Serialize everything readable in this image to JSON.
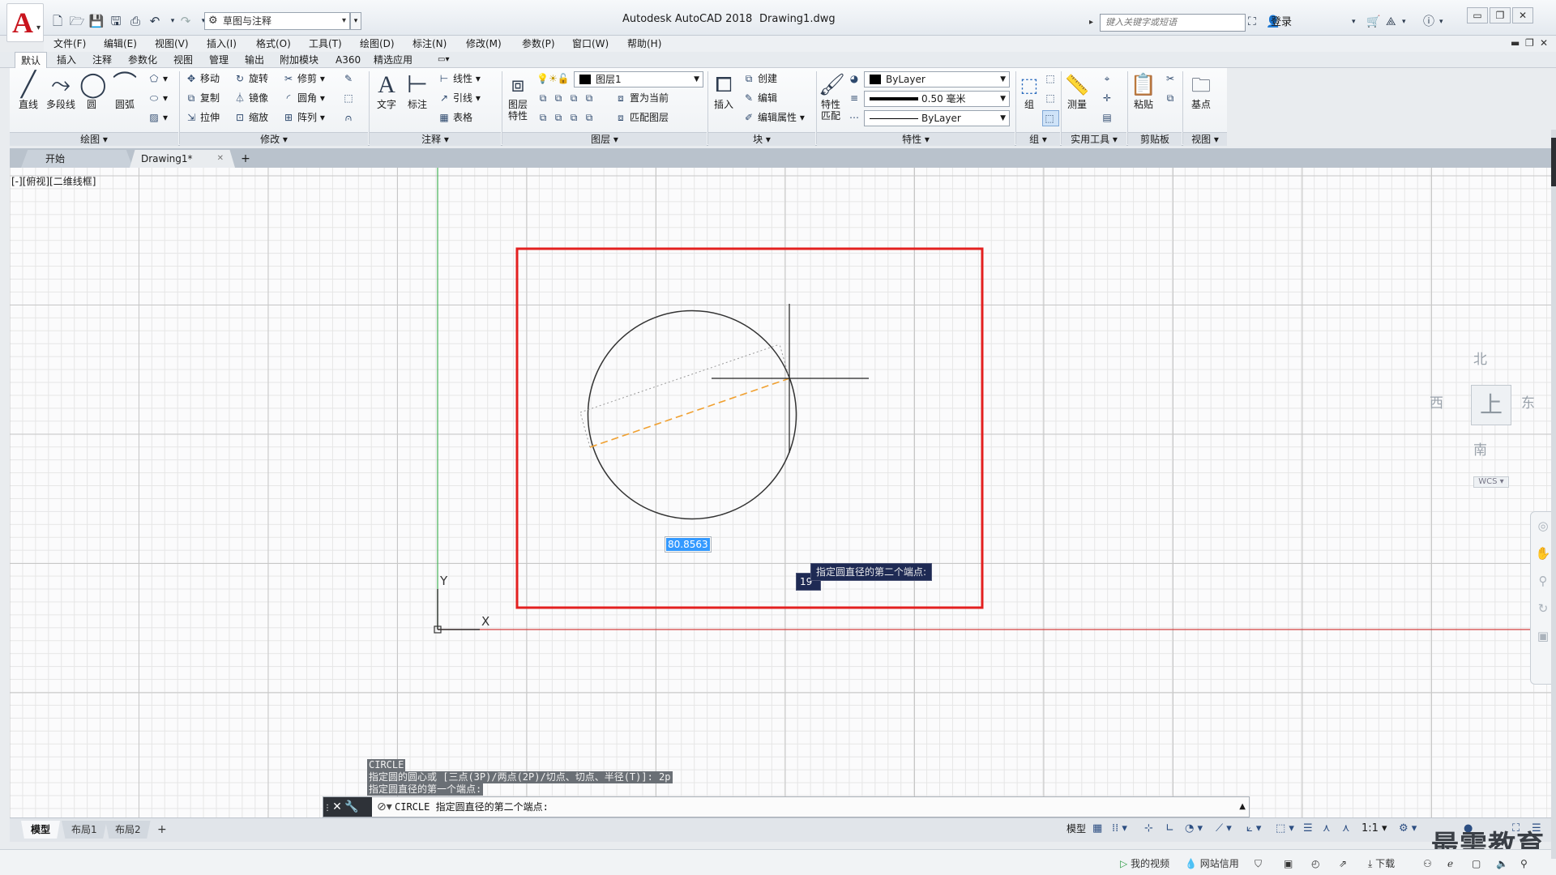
{
  "titlebar": {
    "app_title": "Autodesk AutoCAD 2018",
    "doc_name": "Drawing1.dwg",
    "workspace": "草图与注释",
    "search_placeholder": "键入关键字或短语",
    "login": "登录"
  },
  "menu": [
    "文件(F)",
    "编辑(E)",
    "视图(V)",
    "插入(I)",
    "格式(O)",
    "工具(T)",
    "绘图(D)",
    "标注(N)",
    "修改(M)",
    "参数(P)",
    "窗口(W)",
    "帮助(H)"
  ],
  "ribbon_tabs": [
    "默认",
    "插入",
    "注释",
    "参数化",
    "视图",
    "管理",
    "输出",
    "附加模块",
    "A360",
    "精选应用"
  ],
  "ribbon": {
    "draw": {
      "title": "绘图",
      "line": "直线",
      "polyline": "多段线",
      "circle": "圆",
      "arc": "圆弧"
    },
    "modify": {
      "title": "修改",
      "move": "移动",
      "rotate": "旋转",
      "trim": "修剪",
      "copy": "复制",
      "mirror": "镜像",
      "fillet": "圆角",
      "stretch": "拉伸",
      "scale": "缩放",
      "array": "阵列"
    },
    "annotation": {
      "title": "注释",
      "text": "文字",
      "dim": "标注",
      "linear": "线性",
      "leader": "引线",
      "table": "表格"
    },
    "layers": {
      "title": "图层",
      "props_line1": "图层",
      "props_line2": "特性",
      "layer_name": "图层1",
      "set_current": "置为当前",
      "match_layer": "匹配图层"
    },
    "block": {
      "title": "块",
      "insert": "插入",
      "create": "创建",
      "edit": "编辑",
      "edit_attr": "编辑属性"
    },
    "properties": {
      "title": "特性",
      "match_line1": "特性",
      "match_line2": "匹配",
      "color": "ByLayer",
      "lineweight": "0.50 毫米",
      "linetype": "ByLayer"
    },
    "groups": {
      "title": "组",
      "group": "组"
    },
    "utilities": {
      "title": "实用工具",
      "measure": "测量"
    },
    "clipboard": {
      "title": "剪贴板",
      "paste": "粘贴"
    },
    "view": {
      "title": "视图",
      "base": "基点"
    }
  },
  "file_tabs": {
    "start": "开始",
    "drawing": "Drawing1*"
  },
  "viewport": {
    "label": "[-][俯视][二维线框]",
    "dim_value": "80.8563",
    "tooltip": "指定圆直径的第二个端点:",
    "angle": "19°",
    "ucs_x": "X",
    "ucs_y": "Y"
  },
  "viewcube": {
    "north": "北",
    "south": "南",
    "east": "东",
    "west": "西",
    "top": "上",
    "wcs": "WCS"
  },
  "command": {
    "history": [
      "CIRCLE",
      "指定圆的圆心或 [三点(3P)/两点(2P)/切点、切点、半径(T)]: 2p",
      "指定圆直径的第一个端点:"
    ],
    "current": "CIRCLE 指定圆直径的第二个端点:"
  },
  "layout_tabs": [
    "模型",
    "布局1",
    "布局2"
  ],
  "status": {
    "model": "模型",
    "scale": "1:1"
  },
  "taskbar": {
    "my_video": "我的视频",
    "site_credit": "网站信用",
    "download": "下载"
  },
  "watermark": "最需教育",
  "colors": {
    "accent": "#c9151e",
    "highlight_rect": "#e32020",
    "selection": "#3399ff",
    "tooltip_bg": "#1e2a54"
  }
}
